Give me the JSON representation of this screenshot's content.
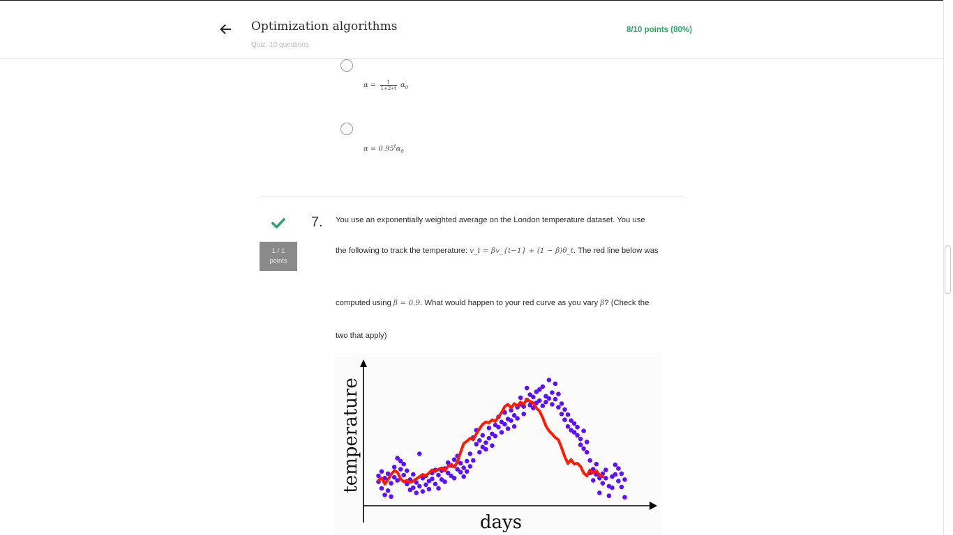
{
  "header": {
    "title": "Optimization algorithms",
    "subtitle": "Quiz, 10 questions",
    "score": "8/10 points (80%)",
    "back_icon": "arrow-left-icon"
  },
  "previous_question_options": [
    {
      "lhs": "α =",
      "frac_num": "1",
      "frac_den": "1+2∗t",
      "rhs": "α",
      "rhs_sub": "0"
    },
    {
      "lhs": "α = 0.95",
      "sup": "t",
      "rhs": "α",
      "rhs_sub": "0"
    }
  ],
  "question": {
    "number": "7.",
    "status_icon": "checkmark-icon",
    "status_color": "#2fa36b",
    "points_line1": "1 / 1",
    "points_line2": "points",
    "line1": "You use an exponentially weighted average on the London temperature dataset. You use",
    "line2_pre": "the following to track the temperature: ",
    "line2_math": "v_t = βv_{t−1} + (1 − β)θ_t",
    "line2_post": ". The red line below was",
    "line3_pre": "computed using ",
    "line3_math": "β = 0.9",
    "line3_mid": ". What would happen to your red curve as you vary ",
    "line3_math2": "β",
    "line3_post": "? (Check the",
    "line4": "two that apply)"
  },
  "chart_data": {
    "type": "scatter",
    "xlabel": "days",
    "ylabel": "temperature",
    "dot_color": "#5c10ff",
    "line_color": "#ff1a00",
    "series": [
      {
        "kind": "scatter",
        "points": [
          [
            1,
            3.2
          ],
          [
            1,
            2.4
          ],
          [
            2,
            1.5
          ],
          [
            2,
            3.8
          ],
          [
            3,
            0.6
          ],
          [
            3,
            2.9
          ],
          [
            4,
            1.2
          ],
          [
            4,
            3.5
          ],
          [
            5,
            2.2
          ],
          [
            5,
            0.4
          ],
          [
            6,
            4.4
          ],
          [
            6,
            3.0
          ],
          [
            7,
            5.6
          ],
          [
            7,
            2.6
          ],
          [
            8,
            4.1
          ],
          [
            8,
            5.2
          ],
          [
            9,
            3.3
          ],
          [
            9,
            4.8
          ],
          [
            10,
            2.1
          ],
          [
            10,
            3.9
          ],
          [
            11,
            1.3
          ],
          [
            11,
            2.7
          ],
          [
            12,
            3.4
          ],
          [
            12,
            1.6
          ],
          [
            13,
            2.3
          ],
          [
            13,
            0.9
          ],
          [
            14,
            1.8
          ],
          [
            14,
            6.2
          ],
          [
            15,
            2.9
          ],
          [
            15,
            1.1
          ],
          [
            16,
            2.0
          ],
          [
            16,
            3.2
          ],
          [
            17,
            1.4
          ],
          [
            17,
            2.5
          ],
          [
            18,
            3.6
          ],
          [
            18,
            2.8
          ],
          [
            19,
            2.1
          ],
          [
            19,
            4.0
          ],
          [
            20,
            3.3
          ],
          [
            20,
            1.5
          ],
          [
            21,
            2.7
          ],
          [
            21,
            3.9
          ],
          [
            22,
            4.2
          ],
          [
            22,
            2.4
          ],
          [
            23,
            3.6
          ],
          [
            23,
            5.0
          ],
          [
            24,
            4.6
          ],
          [
            24,
            3.2
          ],
          [
            25,
            5.4
          ],
          [
            25,
            2.9
          ],
          [
            26,
            4.1
          ],
          [
            26,
            5.9
          ],
          [
            27,
            3.7
          ],
          [
            27,
            4.9
          ],
          [
            28,
            4.3
          ],
          [
            28,
            3.1
          ],
          [
            29,
            5.2
          ],
          [
            29,
            3.8
          ],
          [
            30,
            4.5
          ],
          [
            30,
            6.2
          ],
          [
            31,
            5.3
          ],
          [
            31,
            8.4
          ],
          [
            32,
            9.4
          ],
          [
            32,
            7.5
          ],
          [
            33,
            8.0
          ],
          [
            33,
            6.4
          ],
          [
            34,
            7.1
          ],
          [
            34,
            8.7
          ],
          [
            35,
            6.8
          ],
          [
            35,
            7.7
          ],
          [
            36,
            8.3
          ],
          [
            36,
            9.7
          ],
          [
            37,
            8.9
          ],
          [
            37,
            7.3
          ],
          [
            38,
            10.1
          ],
          [
            38,
            8.6
          ],
          [
            39,
            9.8
          ],
          [
            39,
            11.2
          ],
          [
            40,
            10.5
          ],
          [
            40,
            9.1
          ],
          [
            41,
            11.8
          ],
          [
            41,
            10.2
          ],
          [
            42,
            10.9
          ],
          [
            42,
            9.6
          ],
          [
            43,
            12.1
          ],
          [
            43,
            10.7
          ],
          [
            44,
            11.4
          ],
          [
            44,
            9.9
          ],
          [
            45,
            11.0
          ],
          [
            45,
            12.5
          ],
          [
            46,
            12.9
          ],
          [
            46,
            13.8
          ],
          [
            47,
            12.6
          ],
          [
            47,
            11.6
          ],
          [
            48,
            13.5
          ],
          [
            48,
            15.1
          ],
          [
            49,
            14.2
          ],
          [
            49,
            12.8
          ],
          [
            50,
            13.9
          ],
          [
            50,
            12.4
          ],
          [
            51,
            14.6
          ],
          [
            51,
            13.1
          ],
          [
            52,
            13.4
          ],
          [
            52,
            14.9
          ],
          [
            53,
            12.7
          ],
          [
            53,
            15.3
          ],
          [
            54,
            14.0
          ],
          [
            54,
            13.2
          ],
          [
            55,
            16.2
          ],
          [
            55,
            13.7
          ],
          [
            56,
            14.5
          ],
          [
            56,
            12.9
          ],
          [
            57,
            15.7
          ],
          [
            57,
            13.6
          ],
          [
            58,
            14.3
          ],
          [
            58,
            12.5
          ],
          [
            59,
            13.0
          ],
          [
            59,
            11.6
          ],
          [
            60,
            12.2
          ],
          [
            60,
            10.8
          ],
          [
            61,
            11.5
          ],
          [
            61,
            9.9
          ],
          [
            62,
            10.7
          ],
          [
            62,
            9.4
          ],
          [
            63,
            9.1
          ],
          [
            63,
            10.3
          ],
          [
            64,
            8.7
          ],
          [
            64,
            9.8
          ],
          [
            65,
            8.2
          ],
          [
            65,
            7.4
          ],
          [
            66,
            9.3
          ],
          [
            66,
            6.9
          ],
          [
            67,
            7.8
          ],
          [
            67,
            6.4
          ],
          [
            68,
            5.3
          ],
          [
            68,
            3.6
          ],
          [
            69,
            4.1
          ],
          [
            69,
            2.6
          ],
          [
            70,
            3.4
          ],
          [
            70,
            4.8
          ],
          [
            71,
            2.9
          ],
          [
            71,
            0.9
          ],
          [
            72,
            3.5
          ],
          [
            72,
            2.2
          ],
          [
            73,
            4.0
          ],
          [
            73,
            2.9
          ],
          [
            74,
            1.8
          ],
          [
            74,
            0.5
          ],
          [
            75,
            3.1
          ],
          [
            75,
            1.6
          ],
          [
            76,
            4.7
          ],
          [
            76,
            3.4
          ],
          [
            77,
            2.5
          ],
          [
            77,
            4.2
          ],
          [
            78,
            1.7
          ],
          [
            78,
            3.5
          ],
          [
            79,
            2.7
          ],
          [
            79,
            0.3
          ]
        ]
      },
      {
        "kind": "line",
        "points": [
          [
            1,
            2.6
          ],
          [
            2,
            2.9
          ],
          [
            3,
            2.1
          ],
          [
            4,
            2.7
          ],
          [
            5,
            3.4
          ],
          [
            6,
            3.9
          ],
          [
            7,
            3.7
          ],
          [
            8,
            2.8
          ],
          [
            9,
            2.4
          ],
          [
            10,
            2.6
          ],
          [
            11,
            2.3
          ],
          [
            12,
            2.5
          ],
          [
            13,
            2.8
          ],
          [
            14,
            3.1
          ],
          [
            15,
            3.4
          ],
          [
            16,
            3.2
          ],
          [
            17,
            3.6
          ],
          [
            18,
            4.0
          ],
          [
            19,
            3.8
          ],
          [
            20,
            4.1
          ],
          [
            21,
            4.3
          ],
          [
            22,
            3.9
          ],
          [
            23,
            4.5
          ],
          [
            24,
            4.8
          ],
          [
            25,
            4.4
          ],
          [
            26,
            5.1
          ],
          [
            27,
            6.4
          ],
          [
            28,
            7.6
          ],
          [
            29,
            7.9
          ],
          [
            30,
            8.3
          ],
          [
            31,
            8.1
          ],
          [
            32,
            8.9
          ],
          [
            33,
            9.6
          ],
          [
            34,
            10.2
          ],
          [
            35,
            10.5
          ],
          [
            36,
            10.4
          ],
          [
            37,
            10.8
          ],
          [
            38,
            10.6
          ],
          [
            39,
            11.2
          ],
          [
            40,
            11.8
          ],
          [
            41,
            12.6
          ],
          [
            42,
            12.9
          ],
          [
            43,
            12.4
          ],
          [
            44,
            13.0
          ],
          [
            45,
            12.7
          ],
          [
            46,
            13.2
          ],
          [
            47,
            12.9
          ],
          [
            48,
            13.6
          ],
          [
            49,
            13.3
          ],
          [
            50,
            13.1
          ],
          [
            51,
            12.4
          ],
          [
            52,
            12.0
          ],
          [
            53,
            11.1
          ],
          [
            54,
            10.0
          ],
          [
            55,
            9.3
          ],
          [
            56,
            8.9
          ],
          [
            57,
            8.4
          ],
          [
            58,
            8.1
          ],
          [
            59,
            7.0
          ],
          [
            60,
            5.8
          ],
          [
            61,
            4.9
          ],
          [
            62,
            5.4
          ],
          [
            63,
            4.8
          ],
          [
            64,
            4.9
          ],
          [
            65,
            4.5
          ],
          [
            66,
            3.6
          ],
          [
            67,
            3.2
          ],
          [
            68,
            4.0
          ],
          [
            69,
            3.6
          ],
          [
            70,
            3.9
          ],
          [
            71,
            3.3
          ],
          [
            72,
            3.1
          ]
        ]
      }
    ],
    "xlim": [
      0,
      80
    ],
    "ylim": [
      0,
      17
    ],
    "grid": false
  }
}
